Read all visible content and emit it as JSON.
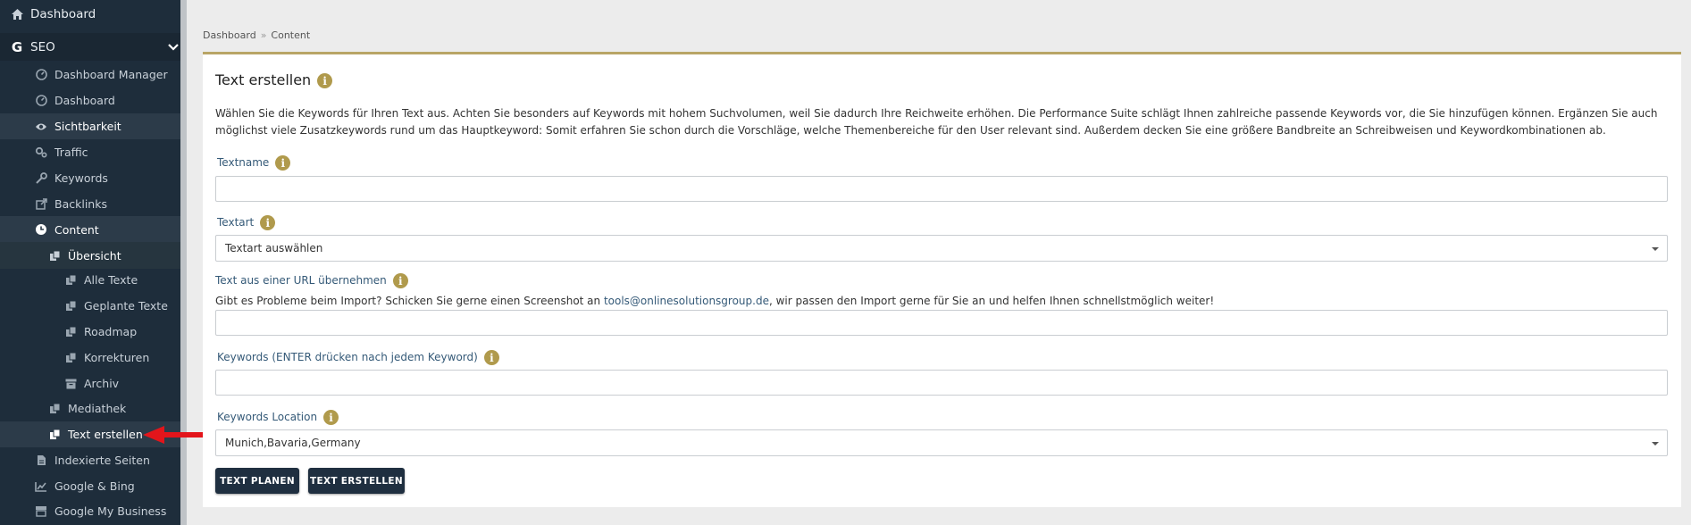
{
  "sidebar": {
    "dashboard": "Dashboard",
    "seo": "SEO",
    "dashboard_manager": "Dashboard Manager",
    "dashboard2": "Dashboard",
    "sichtbarkeit": "Sichtbarkeit",
    "traffic": "Traffic",
    "keywords": "Keywords",
    "backlinks": "Backlinks",
    "content": "Content",
    "uebersicht": "Übersicht",
    "alle_texte": "Alle Texte",
    "geplante_texte": "Geplante Texte",
    "roadmap": "Roadmap",
    "korrekturen": "Korrekturen",
    "archiv": "Archiv",
    "mediathek": "Mediathek",
    "text_erstellen": "Text erstellen",
    "indexierte_seiten": "Indexierte Seiten",
    "google_bing": "Google & Bing",
    "google_my_business": "Google My Business"
  },
  "breadcrumb": {
    "home": "Dashboard",
    "separator": "»",
    "current": "Content"
  },
  "card": {
    "title": "Text erstellen",
    "description": "Wählen Sie die Keywords für Ihren Text aus. Achten Sie besonders auf Keywords mit hohem Suchvolumen, weil Sie dadurch Ihre Reichweite erhöhen. Die Performance Suite schlägt Ihnen zahlreiche passende Keywords vor, die Sie hinzufügen können. Ergänzen Sie auch möglichst viele Zusatzkeywords rund um das Hauptkeyword: Somit erfahren Sie schon durch die Vorschläge, welche Themenbereiche für den User relevant sind. Außerdem decken Sie eine größere Bandbreite an Schreibweisen und Keywordkombinationen ab.",
    "textname_label": "Textname",
    "textname_value": "",
    "textart_label": "Textart",
    "textart_value": "Textart auswählen",
    "url_label": "Text aus einer URL übernehmen",
    "url_hint_before": "Gibt es Probleme beim Import? Schicken Sie gerne einen Screenshot an ",
    "url_hint_email": "tools@onlinesolutionsgroup.de",
    "url_hint_after": ", wir passen den Import gerne für Sie an und helfen Ihnen schnellstmöglich weiter!",
    "url_value": "",
    "keywords_label": "Keywords (ENTER drücken nach jedem Keyword)",
    "keywords_value": "",
    "location_label": "Keywords Location",
    "location_value": "Munich,Bavaria,Germany",
    "btn_planen": "TEXT PLANEN",
    "btn_erstellen": "TEXT ERSTELLEN",
    "info_glyph": "i"
  },
  "colors": {
    "sidebar_bg": "#1e2d3b",
    "accent_gold": "#b09a4c",
    "button_bg": "#1f2f40",
    "arrow_red": "#e3151b"
  }
}
